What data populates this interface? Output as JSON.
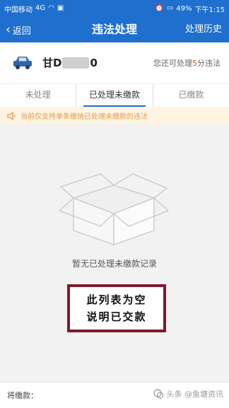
{
  "status_bar": {
    "carrier": "中国移动",
    "network": "4G",
    "battery": "49%",
    "time": "下午1:15"
  },
  "nav": {
    "back_label": "返回",
    "title": "违法处理",
    "history_label": "处理历史"
  },
  "vehicle": {
    "plate_prefix": "甘D",
    "plate_suffix": "0",
    "hint_pre": "您还可处理",
    "hint_count": "5",
    "hint_post": "分违法"
  },
  "tabs": [
    {
      "label": "未处理",
      "active": false
    },
    {
      "label": "已处理未缴款",
      "active": true
    },
    {
      "label": "已缴款",
      "active": false
    }
  ],
  "notice": "当前仅支持单条缴纳已处理未缴款的违法",
  "empty_state": "暂无已处理未缴款记录",
  "overlay": {
    "line1": "此列表为空",
    "line2": "说明已交款"
  },
  "bottom": {
    "due_label": "将缴款：",
    "watermark": "头条 @鱼塘资讯"
  },
  "colors": {
    "primary": "#1e6fce",
    "warning_text": "#e2994b",
    "notice_bg": "#fdf5e2",
    "highlight": "#e8402b",
    "note_border": "#7d1a2c"
  }
}
